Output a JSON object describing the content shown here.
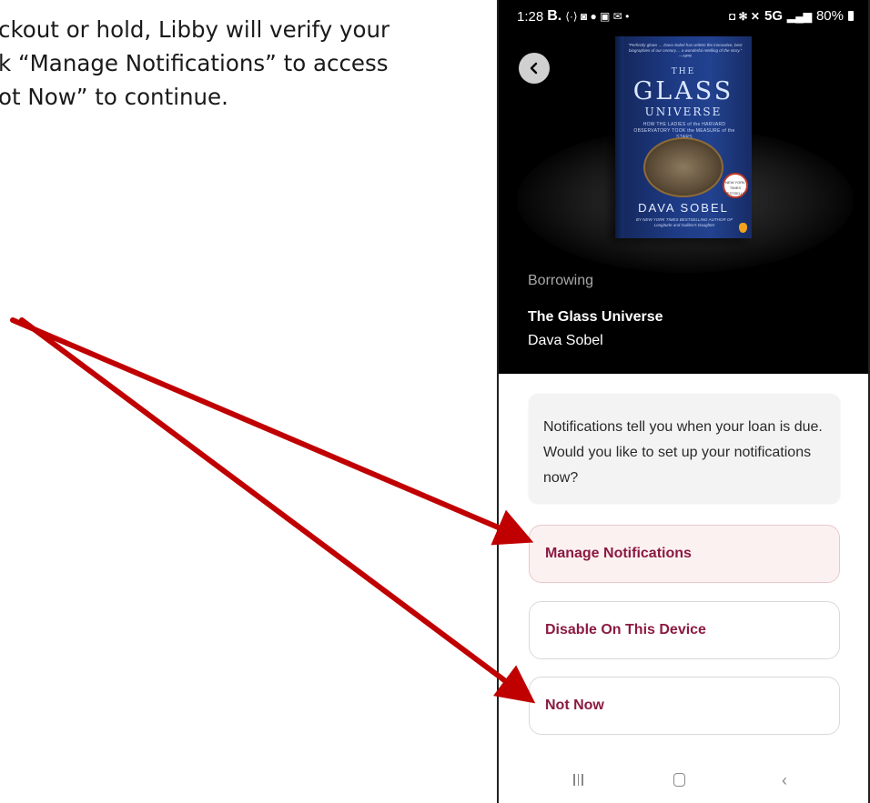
{
  "document": {
    "lines": [
      "ckout or hold, Libby will verify your",
      "k “Manage Notifications” to access",
      "ot Now” to continue."
    ]
  },
  "status_bar": {
    "time": "1:28",
    "left_icons_text": "B.",
    "network": "5G",
    "battery": "80%"
  },
  "cover": {
    "blurb": "“Perfectly glows … Dava Sobel has written the innovative, best biographies of our century… a wonderful retelling of the story.” —NPR",
    "the": "THE",
    "glass": "GLASS",
    "universe": "UNIVERSE",
    "subtitle": "HOW THE LADIES of the HARVARD OBSERVATORY TOOK the MEASURE of the STARS",
    "badge": "NEW YORK TIMES BESTSELLER",
    "author": "DAVA SOBEL",
    "footer": "BY NEW YORK TIMES BESTSELLING AUTHOR OF Longitude and Galileo's Daughter"
  },
  "book": {
    "status": "Borrowing",
    "title": "The Glass Universe",
    "author": "Dava Sobel"
  },
  "notification": {
    "message": "Notifications tell you when your loan is due. Would you like to set up your notifications now?"
  },
  "options": {
    "manage": "Manage Notifications",
    "disable": "Disable On This Device",
    "not_now": "Not Now"
  },
  "colors": {
    "accent": "#8b1a42",
    "arrow": "#c00000"
  },
  "icons": {
    "back": "chevron-left-icon",
    "nav_recent": "recent-apps-icon",
    "nav_home": "home-icon",
    "nav_back": "back-icon"
  }
}
